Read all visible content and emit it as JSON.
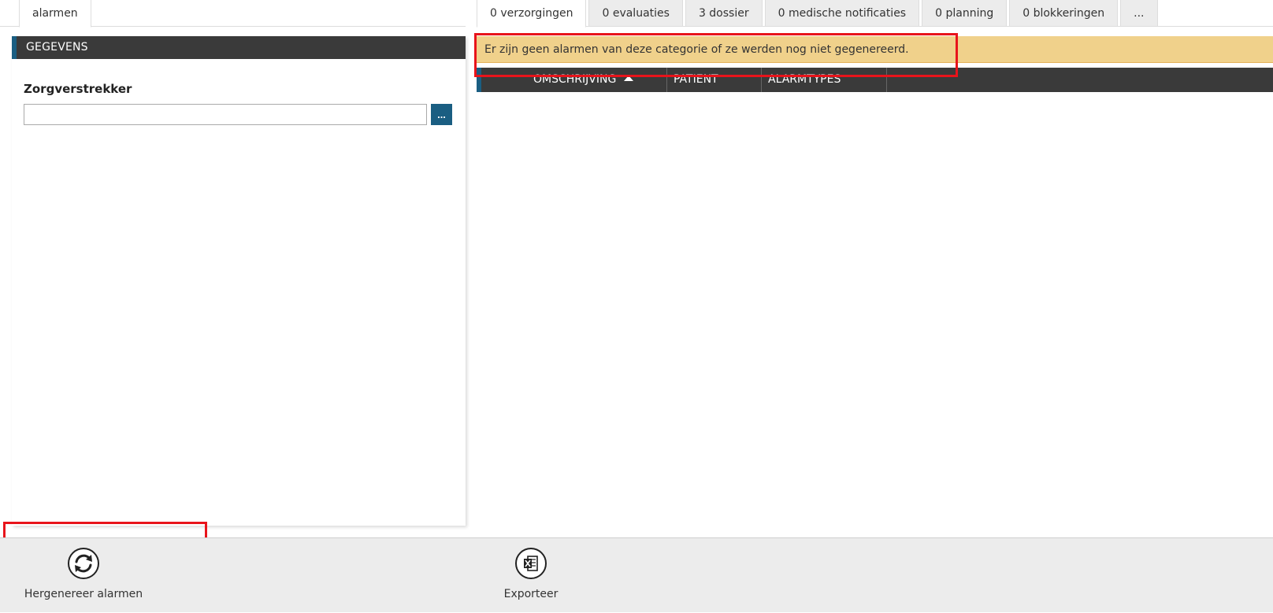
{
  "left_tabs": [
    {
      "label": "alarmen",
      "active": true
    }
  ],
  "right_tabs": [
    {
      "label": "0 verzorgingen",
      "active": true
    },
    {
      "label": "0 evaluaties",
      "active": false
    },
    {
      "label": "3 dossier",
      "active": false
    },
    {
      "label": "0 medische notificaties",
      "active": false
    },
    {
      "label": "0 planning",
      "active": false
    },
    {
      "label": "0 blokkeringen",
      "active": false
    },
    {
      "label": "...",
      "active": false
    }
  ],
  "left_panel": {
    "header": "GEGEVENS",
    "field_label": "Zorgverstrekker",
    "field_value": "",
    "lookup_label": "..."
  },
  "warning": {
    "text": "Er zijn geen alarmen van deze categorie of ze werden nog niet gegenereerd."
  },
  "grid": {
    "columns": [
      "OMSCHRIJVING",
      "PATIENT",
      "ALARMTYPES"
    ],
    "sorted_column": "OMSCHRIJVING",
    "sort_direction": "ascending",
    "rows": []
  },
  "toolbar": {
    "regen_label": "Hergenereer alarmen",
    "regen_icon": "refresh-icon",
    "export_label": "Exporteer",
    "export_icon": "excel-icon"
  },
  "colors": {
    "header_bg": "#3a3a3a",
    "accent": "#1a5e82",
    "warning_bg": "#f0d18b",
    "highlight": "#e8141b"
  }
}
